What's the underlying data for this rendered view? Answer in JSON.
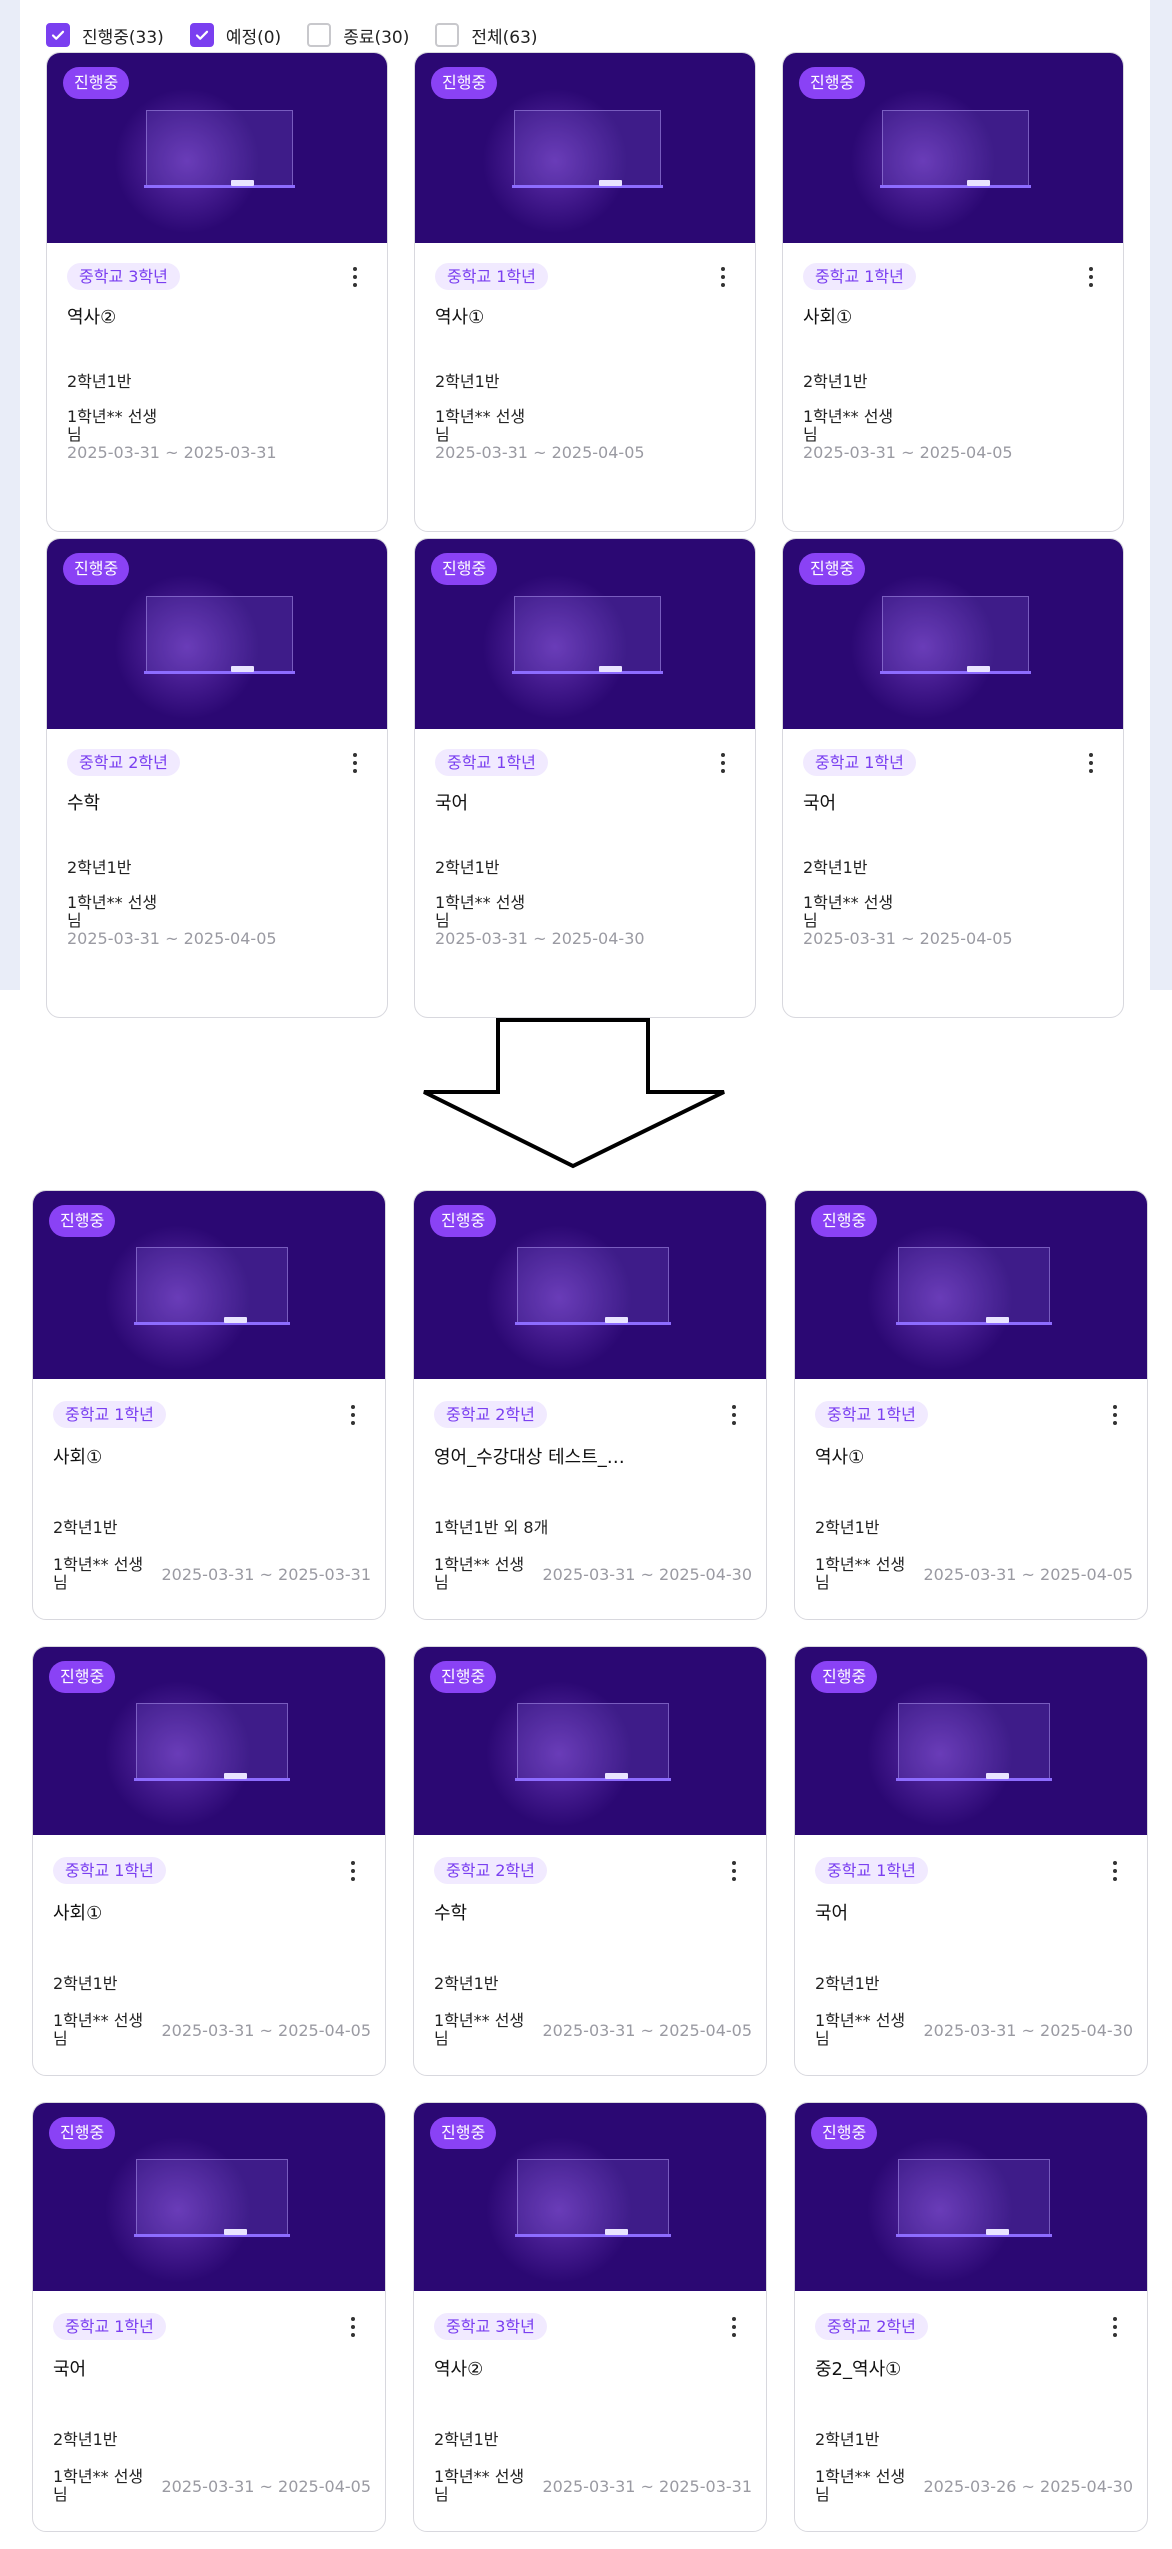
{
  "filters": [
    {
      "label": "진행중(33)",
      "checked": true
    },
    {
      "label": "예정(0)",
      "checked": true
    },
    {
      "label": "종료(30)",
      "checked": false
    },
    {
      "label": "전체(63)",
      "checked": false
    }
  ],
  "top_cards": [
    {
      "status": "진행중",
      "grade": "중학교 3학년",
      "subject": "역사②",
      "class": "2학년1반",
      "teacher": "1학년** 선생\n님",
      "dates": "2025-03-31 ~ 2025-03-31"
    },
    {
      "status": "진행중",
      "grade": "중학교 1학년",
      "subject": "역사①",
      "class": "2학년1반",
      "teacher": "1학년** 선생\n님",
      "dates": "2025-03-31 ~ 2025-04-05"
    },
    {
      "status": "진행중",
      "grade": "중학교 1학년",
      "subject": "사회①",
      "class": "2학년1반",
      "teacher": "1학년** 선생\n님",
      "dates": "2025-03-31 ~ 2025-04-05"
    },
    {
      "status": "진행중",
      "grade": "중학교 2학년",
      "subject": "수학",
      "class": "2학년1반",
      "teacher": "1학년** 선생\n님",
      "dates": "2025-03-31 ~ 2025-04-05"
    },
    {
      "status": "진행중",
      "grade": "중학교 1학년",
      "subject": "국어",
      "class": "2학년1반",
      "teacher": "1학년** 선생\n님",
      "dates": "2025-03-31 ~ 2025-04-30"
    },
    {
      "status": "진행중",
      "grade": "중학교 1학년",
      "subject": "국어",
      "class": "2학년1반",
      "teacher": "1학년** 선생\n님",
      "dates": "2025-03-31 ~ 2025-04-05"
    }
  ],
  "bottom_cards": [
    {
      "status": "진행중",
      "grade": "중학교 1학년",
      "subject": "사회①",
      "class": "2학년1반",
      "teacher": "1학년** 선생\n님",
      "dates": "2025-03-31 ~ 2025-03-31"
    },
    {
      "status": "진행중",
      "grade": "중학교 2학년",
      "subject": "영어_수강대상 테스트_…",
      "class": "1학년1반 외 8개",
      "teacher": "1학년** 선생\n님",
      "dates": "2025-03-31 ~ 2025-04-30"
    },
    {
      "status": "진행중",
      "grade": "중학교 1학년",
      "subject": "역사①",
      "class": "2학년1반",
      "teacher": "1학년** 선생\n님",
      "dates": "2025-03-31 ~ 2025-04-05"
    },
    {
      "status": "진행중",
      "grade": "중학교 1학년",
      "subject": "사회①",
      "class": "2학년1반",
      "teacher": "1학년** 선생\n님",
      "dates": "2025-03-31 ~ 2025-04-05"
    },
    {
      "status": "진행중",
      "grade": "중학교 2학년",
      "subject": "수학",
      "class": "2학년1반",
      "teacher": "1학년** 선생\n님",
      "dates": "2025-03-31 ~ 2025-04-05"
    },
    {
      "status": "진행중",
      "grade": "중학교 1학년",
      "subject": "국어",
      "class": "2학년1반",
      "teacher": "1학년** 선생\n님",
      "dates": "2025-03-31 ~ 2025-04-30"
    },
    {
      "status": "진행중",
      "grade": "중학교 1학년",
      "subject": "국어",
      "class": "2학년1반",
      "teacher": "1학년** 선생\n님",
      "dates": "2025-03-31 ~ 2025-04-05"
    },
    {
      "status": "진행중",
      "grade": "중학교 3학년",
      "subject": "역사②",
      "class": "2학년1반",
      "teacher": "1학년** 선생\n님",
      "dates": "2025-03-31 ~ 2025-03-31"
    },
    {
      "status": "진행중",
      "grade": "중학교 2학년",
      "subject": "중2_역사①",
      "class": "2학년1반",
      "teacher": "1학년** 선생\n님",
      "dates": "2025-03-26 ~ 2025-04-30"
    }
  ],
  "colors": {
    "accent": "#7a3ff0",
    "badge": "#8a42f5",
    "thumb": "#2b0873"
  },
  "icons": {
    "kebab": "more-vertical-icon",
    "check": "check-icon",
    "arrow": "down-arrow-icon"
  }
}
